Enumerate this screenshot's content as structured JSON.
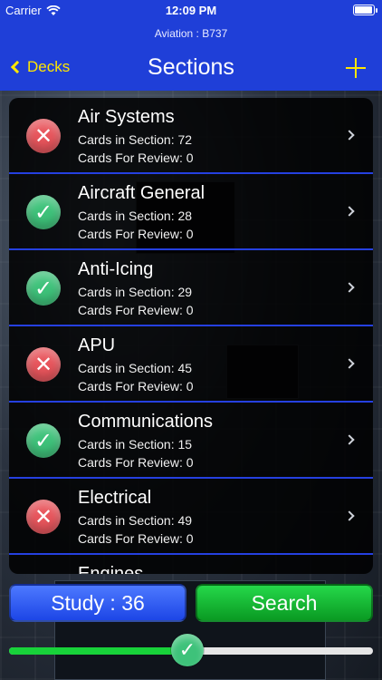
{
  "status_bar": {
    "carrier": "Carrier",
    "time": "12:09 PM",
    "wifi_icon": "wifi-icon",
    "battery_icon": "battery-icon"
  },
  "nav": {
    "subtitle": "Aviation : B737",
    "back_label": "Decks",
    "title": "Sections",
    "add_icon": "plus-icon",
    "accent_color": "#ffe600",
    "bar_color": "#1f3fd8"
  },
  "sections": [
    {
      "name": "Air Systems",
      "cards": "Cards in Section: 72",
      "review": "Cards For Review: 0",
      "status": "fail",
      "symbol": "✕"
    },
    {
      "name": "Aircraft General",
      "cards": "Cards in Section: 28",
      "review": "Cards For Review: 0",
      "status": "pass",
      "symbol": "✓"
    },
    {
      "name": "Anti-Icing",
      "cards": "Cards in Section: 29",
      "review": "Cards For Review: 0",
      "status": "pass",
      "symbol": "✓"
    },
    {
      "name": "APU",
      "cards": "Cards in Section: 45",
      "review": "Cards For Review: 0",
      "status": "fail",
      "symbol": "✕"
    },
    {
      "name": "Communications",
      "cards": "Cards in Section: 15",
      "review": "Cards For Review: 0",
      "status": "pass",
      "symbol": "✓"
    },
    {
      "name": "Electrical",
      "cards": "Cards in Section: 49",
      "review": "Cards For Review: 0",
      "status": "fail",
      "symbol": "✕"
    },
    {
      "name": "Engines",
      "cards": "",
      "review": "",
      "status": "partial",
      "symbol": ""
    }
  ],
  "buttons": {
    "study_label": "Study : 36",
    "search_label": "Search"
  },
  "progress": {
    "fraction": 0.49,
    "thumb_symbol": "✓"
  }
}
